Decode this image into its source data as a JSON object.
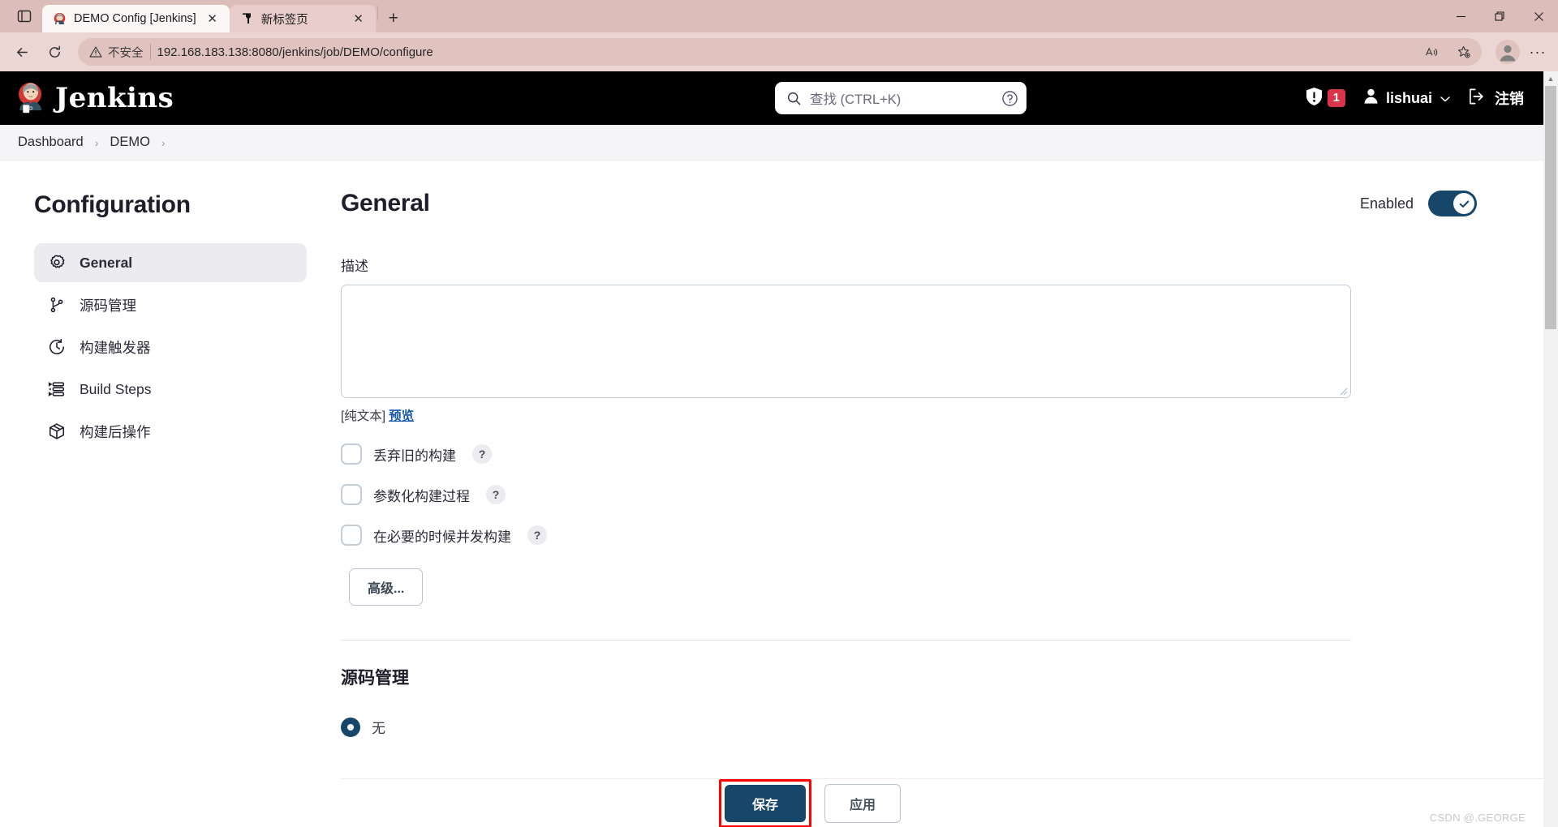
{
  "browser": {
    "tabs": [
      {
        "title": "DEMO Config [Jenkins]",
        "favicon": "jenkins-icon",
        "active": true
      },
      {
        "title": "新标签页",
        "favicon": "edge-icon",
        "active": false
      }
    ],
    "new_tab_label": "+",
    "close_label": "✕",
    "window_controls": {
      "minimize": "—",
      "maximize": "▢",
      "close": "✕"
    },
    "nav": {
      "back": "←",
      "reload": "⟳"
    },
    "omnibox": {
      "security_label": "不安全",
      "url": "192.168.183.138:8080/jenkins/job/DEMO/configure",
      "read_aloud_icon": "read-aloud-icon",
      "favorite_icon": "add-favorite-icon"
    },
    "profile_icon": "profile-icon",
    "more_label": "···"
  },
  "jenkins": {
    "brand": "Jenkins",
    "search": {
      "placeholder": "查找 (CTRL+K)",
      "icon": "search-icon",
      "help_icon": "help-circle-icon"
    },
    "alerts": {
      "icon": "security-warning-icon",
      "count": "1"
    },
    "user": {
      "name": "lishuai",
      "icon": "person-icon",
      "chevron": "⌄"
    },
    "logout": {
      "label": "注销",
      "icon": "logout-icon"
    },
    "breadcrumb": [
      {
        "label": "Dashboard"
      },
      {
        "label": "DEMO"
      }
    ],
    "breadcrumb_sep": "›"
  },
  "sidebar": {
    "title": "Configuration",
    "items": [
      {
        "label": "General",
        "icon": "gear-icon",
        "active": true
      },
      {
        "label": "源码管理",
        "icon": "branch-icon",
        "active": false
      },
      {
        "label": "构建触发器",
        "icon": "clock-icon",
        "active": false
      },
      {
        "label": "Build Steps",
        "icon": "list-icon",
        "active": false
      },
      {
        "label": "构建后操作",
        "icon": "box-icon",
        "active": false
      }
    ]
  },
  "main": {
    "title": "General",
    "enabled": {
      "label": "Enabled",
      "state": "on",
      "check_icon": "check-icon"
    },
    "description": {
      "label": "描述",
      "value": "",
      "plain_text_note": "[纯文本]",
      "preview_link": "预览"
    },
    "checkboxes": [
      {
        "label": "丢弃旧的构建",
        "checked": false,
        "help": "?"
      },
      {
        "label": "参数化构建过程",
        "checked": false,
        "help": "?"
      },
      {
        "label": "在必要的时候并发构建",
        "checked": false,
        "help": "?"
      }
    ],
    "advanced_button": "高级...",
    "scm": {
      "title": "源码管理",
      "options": [
        {
          "label": "无",
          "selected": true
        }
      ]
    }
  },
  "footer": {
    "save_label": "保存",
    "apply_label": "应用",
    "save_highlight_color": "#ff0000"
  },
  "watermark": "CSDN @.GEORGE",
  "colors": {
    "jenkins_dark": "#16476b",
    "accent_link": "#1557b0",
    "badge_red": "#d9344a",
    "browser_chrome": "#ddbdb9"
  }
}
